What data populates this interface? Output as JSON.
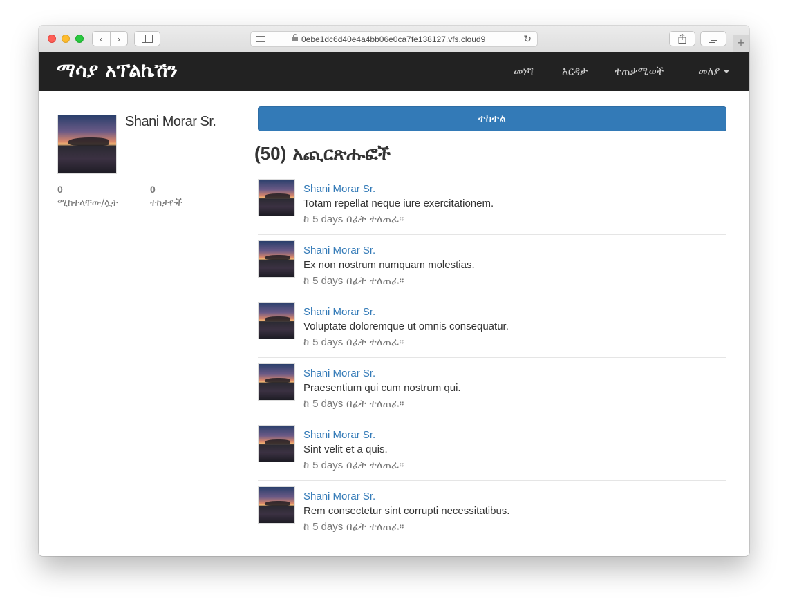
{
  "browser": {
    "url": "0ebe1dc6d40e4a4bb06e0ca7fe138127.vfs.cloud9",
    "new_tab_label": "+"
  },
  "navbar": {
    "brand": "ማሳያ አፕልኬሽን",
    "items": [
      {
        "label": "መነሻ"
      },
      {
        "label": "እርዳታ"
      },
      {
        "label": "ተጠቃሚወች"
      },
      {
        "label": "መለያ"
      }
    ]
  },
  "profile": {
    "name": "Shani Morar Sr.",
    "stats": [
      {
        "count": "0",
        "label": "ሚከተላቸው/ሏት"
      },
      {
        "count": "0",
        "label": "ተከታዮች"
      }
    ]
  },
  "main": {
    "follow_label": "ተከተል",
    "posts_count": "(50)",
    "posts_heading": "አጪርጽሑፎች"
  },
  "posts": [
    {
      "author": "Shani Morar Sr.",
      "content": "Totam repellat neque iure exercitationem.",
      "time_prefix": "ከ",
      "time_ago": "5 days",
      "time_suffix": "በፊት ተለጠፈ።"
    },
    {
      "author": "Shani Morar Sr.",
      "content": "Ex non nostrum numquam molestias.",
      "time_prefix": "ከ",
      "time_ago": "5 days",
      "time_suffix": "በፊት ተለጠፈ።"
    },
    {
      "author": "Shani Morar Sr.",
      "content": "Voluptate doloremque ut omnis consequatur.",
      "time_prefix": "ከ",
      "time_ago": "5 days",
      "time_suffix": "በፊት ተለጠፈ።"
    },
    {
      "author": "Shani Morar Sr.",
      "content": "Praesentium qui cum nostrum qui.",
      "time_prefix": "ከ",
      "time_ago": "5 days",
      "time_suffix": "በፊት ተለጠፈ።"
    },
    {
      "author": "Shani Morar Sr.",
      "content": "Sint velit et a quis.",
      "time_prefix": "ከ",
      "time_ago": "5 days",
      "time_suffix": "በፊት ተለጠፈ።"
    },
    {
      "author": "Shani Morar Sr.",
      "content": "Rem consectetur sint corrupti necessitatibus.",
      "time_prefix": "ከ",
      "time_ago": "5 days",
      "time_suffix": "በፊት ተለጠፈ።"
    }
  ],
  "colors": {
    "navbar_bg": "#222222",
    "link": "#337ab7",
    "button": "#337ab7"
  }
}
